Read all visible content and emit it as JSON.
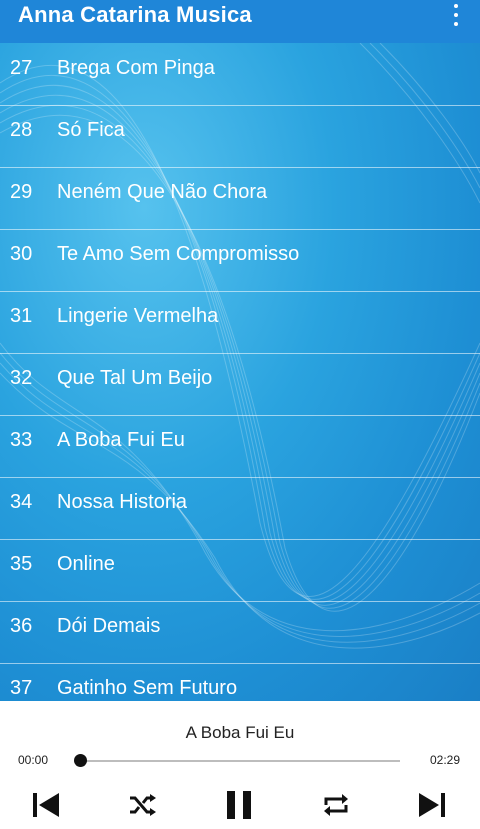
{
  "app": {
    "title": "Anna Catarina Musica",
    "menu_icon": "more-vert-icon"
  },
  "songs": [
    {
      "num": "27",
      "name": "Brega Com Pinga"
    },
    {
      "num": "28",
      "name": "Só Fica"
    },
    {
      "num": "29",
      "name": "Neném Que Não Chora"
    },
    {
      "num": "30",
      "name": "Te Amo Sem Compromisso"
    },
    {
      "num": "31",
      "name": "Lingerie Vermelha"
    },
    {
      "num": "32",
      "name": "Que Tal Um Beijo"
    },
    {
      "num": "33",
      "name": "A Boba Fui Eu"
    },
    {
      "num": "34",
      "name": "Nossa Historia"
    },
    {
      "num": "35",
      "name": "Online"
    },
    {
      "num": "36",
      "name": "Dói Demais"
    },
    {
      "num": "37",
      "name": "Gatinho Sem Futuro"
    }
  ],
  "player": {
    "now_playing": "A Boba Fui Eu",
    "time_current": "00:00",
    "time_total": "02:29",
    "progress": 0.0,
    "controls": [
      "skip-previous-icon",
      "shuffle-icon",
      "pause-icon",
      "repeat-icon",
      "skip-next-icon"
    ]
  },
  "colors": {
    "appbar": "#1f86d8",
    "list_bg": "#2aa3df",
    "text_light": "#ffffff"
  }
}
